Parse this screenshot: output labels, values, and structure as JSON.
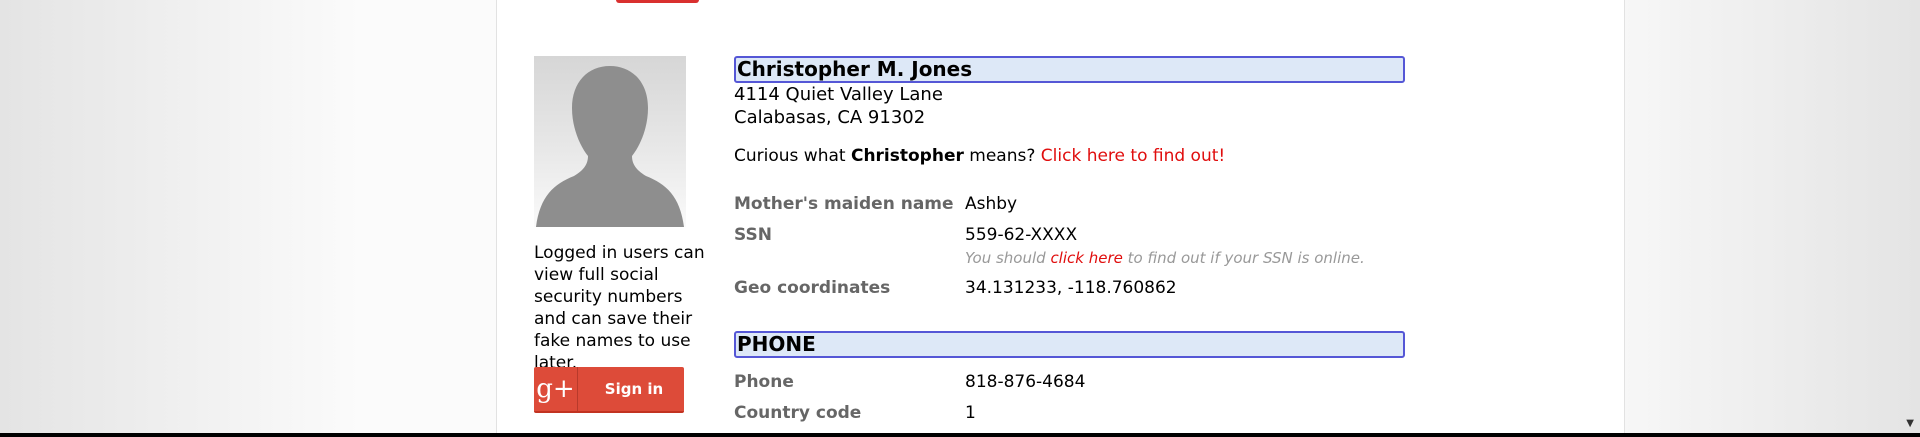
{
  "person": {
    "name": "Christopher M. Jones",
    "address_line1": "4114 Quiet Valley Lane",
    "address_line2": "Calabasas, CA 91302"
  },
  "curious": {
    "prefix": "Curious what ",
    "first_name": "Christopher",
    "middle": " means? ",
    "link": "Click here to find out!"
  },
  "details": {
    "maiden_label": "Mother's maiden name",
    "maiden_value": "Ashby",
    "ssn_label": "SSN",
    "ssn_value": "559-62-XXXX",
    "ssn_note_prefix": "You should ",
    "ssn_note_link": "click here",
    "ssn_note_suffix": " to find out if your SSN is online.",
    "geo_label": "Geo coordinates",
    "geo_value": "34.131233, -118.760862"
  },
  "phone_section": {
    "title": "PHONE",
    "phone_label": "Phone",
    "phone_value": "818-876-4684",
    "country_label": "Country code",
    "country_value": "1"
  },
  "sidebar": {
    "login_text": "Logged in users can view full social security numbers and can save their fake names to use later.",
    "signin_icon": "g+",
    "signin_label": "Sign in"
  },
  "colors": {
    "accent_red": "#e00d0d",
    "google_red": "#dd4b39",
    "box_bg": "#dde8f7",
    "box_border": "#5557d6"
  },
  "icons": {
    "avatar": "person-silhouette-icon",
    "google_plus": "google-plus-icon",
    "scroll_down": "scroll-down-arrow-icon"
  }
}
